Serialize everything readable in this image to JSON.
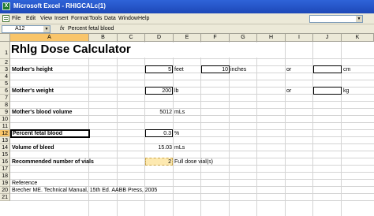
{
  "window": {
    "title": "Microsoft Excel - RHIGCALc(1)",
    "app_icon": "X"
  },
  "menubar": {
    "items": [
      "File",
      "Edit",
      "View",
      "Insert",
      "Format",
      "Tools",
      "Data",
      "Window",
      "Help"
    ],
    "help_box_value": ""
  },
  "formulabar": {
    "namebox": "A12",
    "fx": "fx",
    "formula": "Percent fetal blood"
  },
  "columns": [
    "A",
    "B",
    "C",
    "D",
    "E",
    "F",
    "G",
    "H",
    "I",
    "J",
    "K"
  ],
  "rows": [
    "1",
    "2",
    "3",
    "4",
    "5",
    "6",
    "7",
    "8",
    "9",
    "10",
    "11",
    "12",
    "13",
    "14",
    "15",
    "16",
    "17",
    "18",
    "19",
    "20",
    "21"
  ],
  "active": {
    "column": "A",
    "row": "12"
  },
  "sheet": {
    "title": "Rhlg Dose Calculator",
    "mothers_height_label": "Mother's height",
    "height_feet_value": "5",
    "height_feet_unit": "feet",
    "height_inches_value": "10",
    "height_inches_unit": "inches",
    "height_or": "or",
    "height_cm_value": "",
    "height_cm_unit": "cm",
    "mothers_weight_label": "Mother's weight",
    "weight_lb_value": "200",
    "weight_lb_unit": "lb",
    "weight_or": "or",
    "weight_kg_value": "",
    "weight_kg_unit": "kg",
    "blood_volume_label": "Mother's blood volume",
    "blood_volume_value": "5012",
    "blood_volume_unit": "mLs",
    "percent_fetal_label": "Percent fetal blood",
    "percent_fetal_value": "0.3",
    "percent_fetal_unit": "%",
    "bleed_volume_label": "Volume of bleed",
    "bleed_volume_value": "15.03",
    "bleed_volume_unit": "mLs",
    "vials_label": "Recommended number of vials",
    "vials_value": "2",
    "vials_unit": "Full dose vial(s)",
    "reference_label": "Reference",
    "reference_text": "Brecher ME.  Technical Manual, 15th Ed.  AABB Press, 2005"
  }
}
